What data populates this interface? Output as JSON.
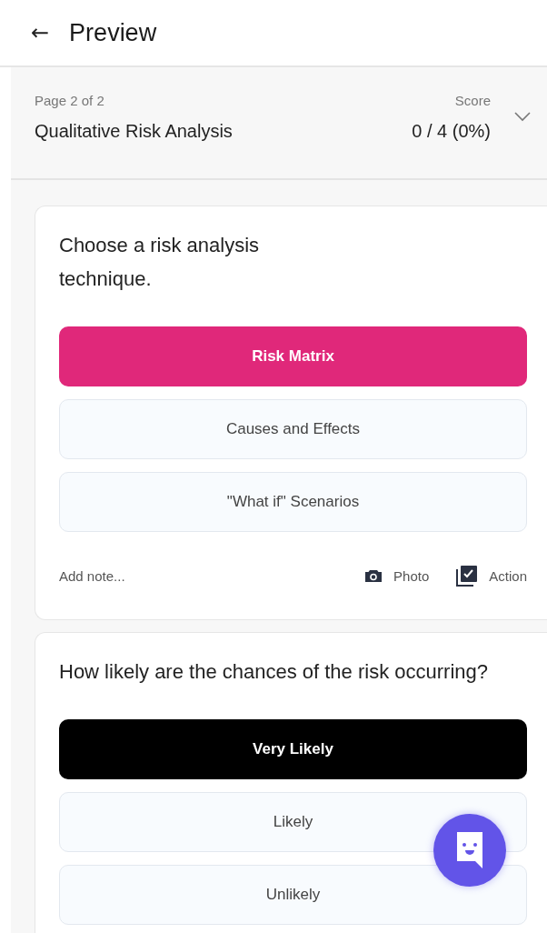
{
  "header": {
    "back": "←",
    "title": "Preview"
  },
  "page_info": {
    "page": "Page 2 of 2",
    "section": "Qualitative Risk Analysis",
    "score_label": "Score",
    "score": "0 / 4 (0%)",
    "expanded": false
  },
  "questions": [
    {
      "text": "Choose a risk analysis technique.",
      "color": "#e0287a",
      "options": [
        {
          "label": "Risk Matrix",
          "selected": true
        },
        {
          "label": "Causes and Effects",
          "selected": false
        },
        {
          "label": "\"What if\" Scenarios",
          "selected": false
        }
      ],
      "footer": {
        "note": "Add note...",
        "photo": "Photo",
        "action": "Action"
      }
    },
    {
      "text": "How likely are the chances of the risk occurring?",
      "color": "#000000",
      "options": [
        {
          "label": "Very Likely",
          "selected": true
        },
        {
          "label": "Likely",
          "selected": false
        },
        {
          "label": "Unlikely",
          "selected": false
        }
      ]
    }
  ]
}
